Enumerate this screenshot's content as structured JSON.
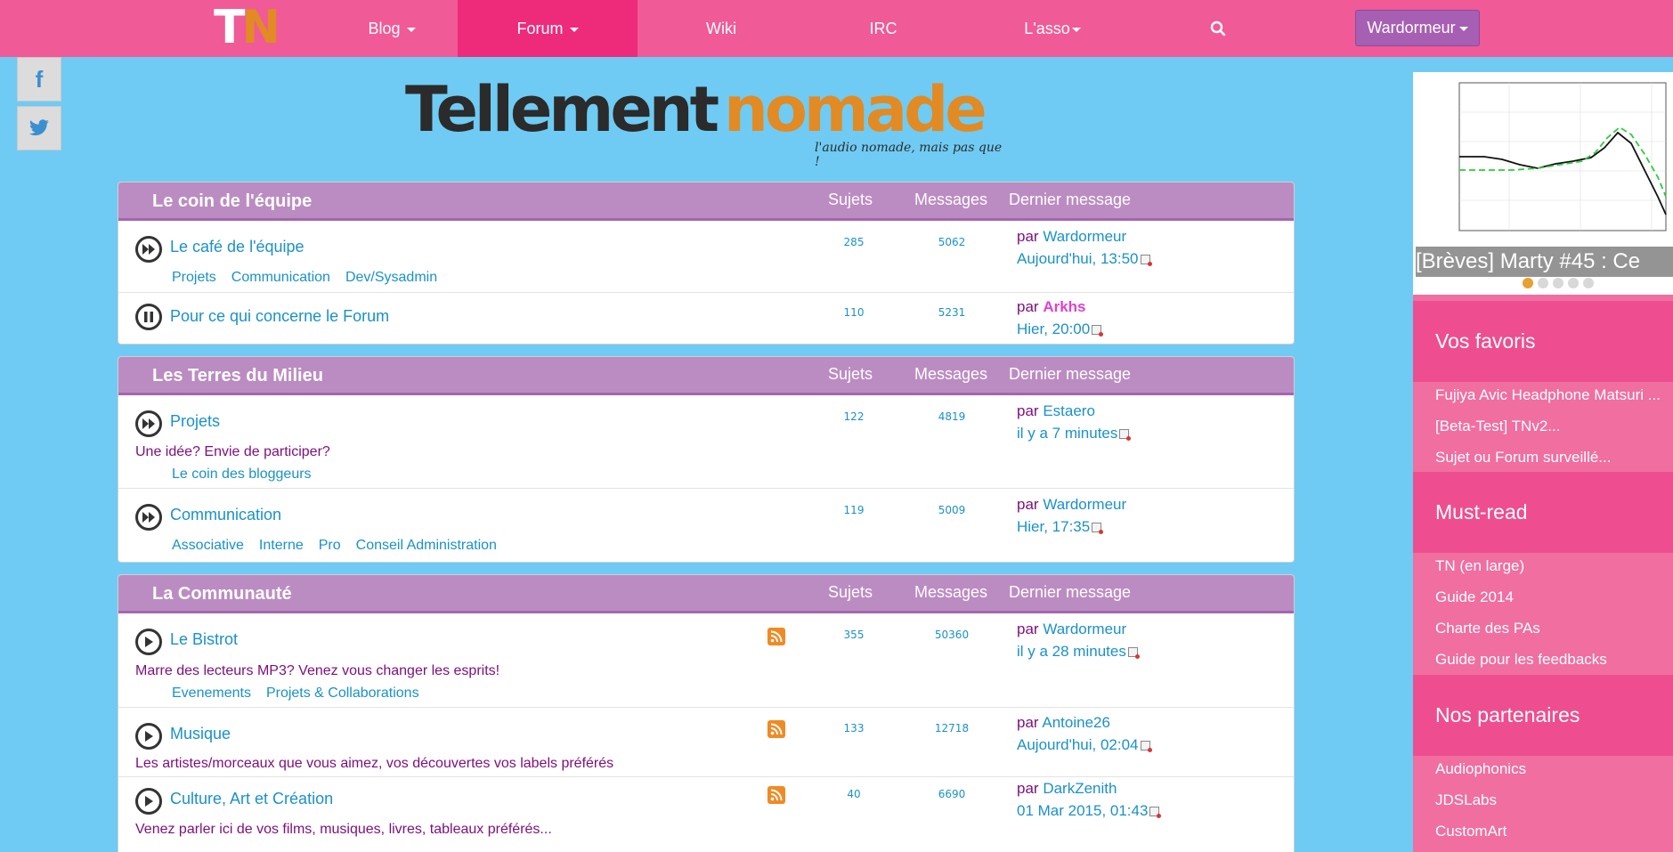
{
  "nav": {
    "logo_part1": "T",
    "logo_part2": "N",
    "items": [
      {
        "label": "Blog",
        "dropdown": true
      },
      {
        "label": "Forum",
        "dropdown": true
      },
      {
        "label": "Wiki",
        "dropdown": false
      },
      {
        "label": "IRC",
        "dropdown": false
      },
      {
        "label": "L'asso",
        "dropdown": true
      }
    ],
    "user": "Wardormeur"
  },
  "social": {
    "facebook": "f",
    "twitter": "t"
  },
  "banner": {
    "part1": "Tellement",
    "part2": "nomade",
    "tagline": "l'audio nomade, mais pas que !"
  },
  "columns": {
    "sujets": "Sujets",
    "messages": "Messages",
    "dernier": "Dernier message",
    "par": "par"
  },
  "sections": [
    {
      "title": "Le coin de l'équipe",
      "forums": [
        {
          "title": "Le café de l'équipe",
          "sujets": "285",
          "messages": "5062",
          "who": "Wardormeur",
          "when": "Aujourd'hui, 13:50",
          "subforums": [
            "Projets",
            "Communication",
            "Dev/Sysadmin"
          ]
        },
        {
          "title": "Pour ce qui concerne le Forum",
          "sujets": "110",
          "messages": "5231",
          "who": "Arkhs",
          "when": "Hier, 20:00"
        }
      ]
    },
    {
      "title": "Les Terres du Milieu",
      "forums": [
        {
          "title": "Projets",
          "desc": "Une idée? Envie de participer?",
          "sujets": "122",
          "messages": "4819",
          "who": "Estaero",
          "when": "il y a 7 minutes",
          "subforums": [
            "Le coin des bloggeurs"
          ]
        },
        {
          "title": "Communication",
          "sujets": "119",
          "messages": "5009",
          "who": "Wardormeur",
          "when": "Hier, 17:35",
          "subforums": [
            "Associative",
            "Interne",
            "Pro",
            "Conseil Administration"
          ]
        }
      ]
    },
    {
      "title": "La Communauté",
      "forums": [
        {
          "title": "Le Bistrot",
          "desc": "Marre des lecteurs MP3? Venez vous changer les esprits!",
          "sujets": "355",
          "messages": "50360",
          "who": "Wardormeur",
          "when": "il y a 28 minutes",
          "subforums": [
            "Evenements",
            "Projets & Collaborations"
          ]
        },
        {
          "title": "Musique",
          "desc": "Les artistes/morceaux que vous aimez, vos découvertes vos labels préférés",
          "sujets": "133",
          "messages": "12718",
          "who": "Antoine26",
          "when": "Aujourd'hui, 02:04"
        },
        {
          "title": "Culture, Art et Création",
          "desc": "Venez parler ici de vos films, musiques, livres, tableaux préférés...",
          "sujets": "40",
          "messages": "6690",
          "who": "DarkZenith",
          "when": "01 Mar 2015, 01:43"
        }
      ]
    }
  ],
  "sidebar": {
    "caption": "[Brèves] Marty #45 : Ce",
    "favoris_title": "Vos favoris",
    "favoris": [
      "Fujiya Avic Headphone Matsuri ...",
      "[Beta-Test] TNv2...",
      "Sujet ou Forum surveillé..."
    ],
    "mustread_title": "Must-read",
    "mustread": [
      "TN (en large)",
      "Guide 2014",
      "Charte des PAs",
      "Guide pour les feedbacks"
    ],
    "partners_title": "Nos partenaires",
    "partners": [
      "Audiophonics",
      "JDSLabs",
      "CustomArt"
    ]
  },
  "colors": {
    "navbar": "#f05a96",
    "nav_active": "#ee2a7b",
    "background": "#6fcbf3",
    "section_header": "#bb8cc2",
    "link": "#1a91c9",
    "desc": "#7d0e7d"
  }
}
